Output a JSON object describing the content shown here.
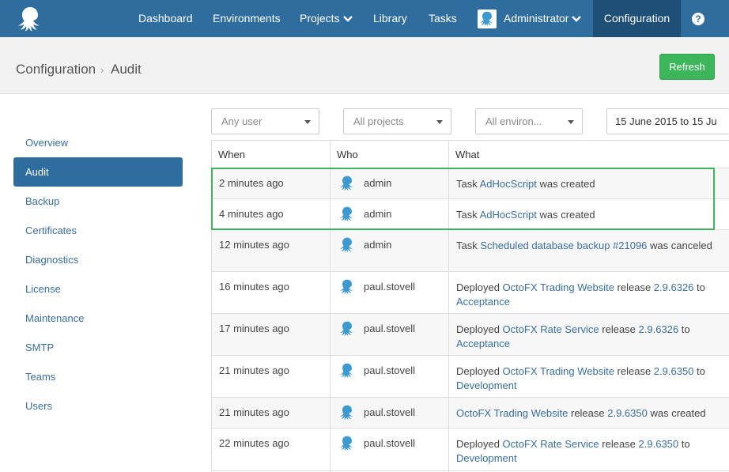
{
  "nav": {
    "logo": "octopus-logo",
    "items": [
      {
        "label": "Dashboard"
      },
      {
        "label": "Environments"
      },
      {
        "label": "Projects"
      },
      {
        "label": "Library"
      },
      {
        "label": "Tasks"
      }
    ],
    "user": {
      "label": "Administrator"
    },
    "active": {
      "label": "Configuration"
    },
    "help_label": "?"
  },
  "breadcrumb": {
    "parent": "Configuration",
    "separator": "›",
    "current": "Audit"
  },
  "refresh_label": "Refresh",
  "sidebar": {
    "items": [
      {
        "label": "Overview"
      },
      {
        "label": "Audit"
      },
      {
        "label": "Backup"
      },
      {
        "label": "Certificates"
      },
      {
        "label": "Diagnostics"
      },
      {
        "label": "License"
      },
      {
        "label": "Maintenance"
      },
      {
        "label": "SMTP"
      },
      {
        "label": "Teams"
      },
      {
        "label": "Users"
      }
    ],
    "active_index": 1
  },
  "filters": {
    "user": "Any user",
    "projects": "All projects",
    "environments": "All environ...",
    "date_range": "15 June 2015 to 15 Ju"
  },
  "table": {
    "headers": {
      "when": "When",
      "who": "Who",
      "what": "What"
    },
    "rows": [
      {
        "when": "2 minutes ago",
        "who": "admin",
        "what": [
          [
            "t",
            "Task "
          ],
          [
            "l",
            "AdHocScript"
          ],
          [
            "t",
            " was created"
          ]
        ]
      },
      {
        "when": "4 minutes ago",
        "who": "admin",
        "what": [
          [
            "t",
            "Task "
          ],
          [
            "l",
            "AdHocScript"
          ],
          [
            "t",
            " was created"
          ]
        ]
      },
      {
        "when": "12 minutes ago",
        "who": "admin",
        "what": [
          [
            "t",
            "Task "
          ],
          [
            "l",
            "Scheduled database backup #21096"
          ],
          [
            "t",
            " was canceled"
          ]
        ]
      },
      {
        "when": "16 minutes ago",
        "who": "paul.stovell",
        "what": [
          [
            "t",
            "Deployed "
          ],
          [
            "l",
            "OctoFX Trading Website"
          ],
          [
            "t",
            " release "
          ],
          [
            "l",
            "2.9.6326"
          ],
          [
            "t",
            " to "
          ],
          [
            "l",
            "Acceptance"
          ]
        ]
      },
      {
        "when": "17 minutes ago",
        "who": "paul.stovell",
        "what": [
          [
            "t",
            "Deployed "
          ],
          [
            "l",
            "OctoFX Rate Service"
          ],
          [
            "t",
            " release "
          ],
          [
            "l",
            "2.9.6326"
          ],
          [
            "t",
            " to "
          ],
          [
            "l",
            "Acceptance"
          ]
        ]
      },
      {
        "when": "21 minutes ago",
        "who": "paul.stovell",
        "what": [
          [
            "t",
            "Deployed "
          ],
          [
            "l",
            "OctoFX Trading Website"
          ],
          [
            "t",
            " release "
          ],
          [
            "l",
            "2.9.6350"
          ],
          [
            "t",
            " to "
          ],
          [
            "l",
            "Development"
          ]
        ]
      },
      {
        "when": "21 minutes ago",
        "who": "paul.stovell",
        "what": [
          [
            "l",
            "OctoFX Trading Website"
          ],
          [
            "t",
            " release "
          ],
          [
            "l",
            "2.9.6350"
          ],
          [
            "t",
            " was created"
          ]
        ]
      },
      {
        "when": "22 minutes ago",
        "who": "paul.stovell",
        "what": [
          [
            "t",
            "Deployed "
          ],
          [
            "l",
            "OctoFX Rate Service"
          ],
          [
            "t",
            " release "
          ],
          [
            "l",
            "2.9.6350"
          ],
          [
            "t",
            " to "
          ],
          [
            "l",
            "Development"
          ]
        ]
      }
    ]
  },
  "colors": {
    "nav_bg": "#2f6d9e",
    "nav_active_bg": "#1e4f77",
    "link": "#3a6e9a",
    "refresh_bg": "#3cb55b",
    "highlight": "#3cb55b",
    "octopus": "#3d9ad1"
  }
}
